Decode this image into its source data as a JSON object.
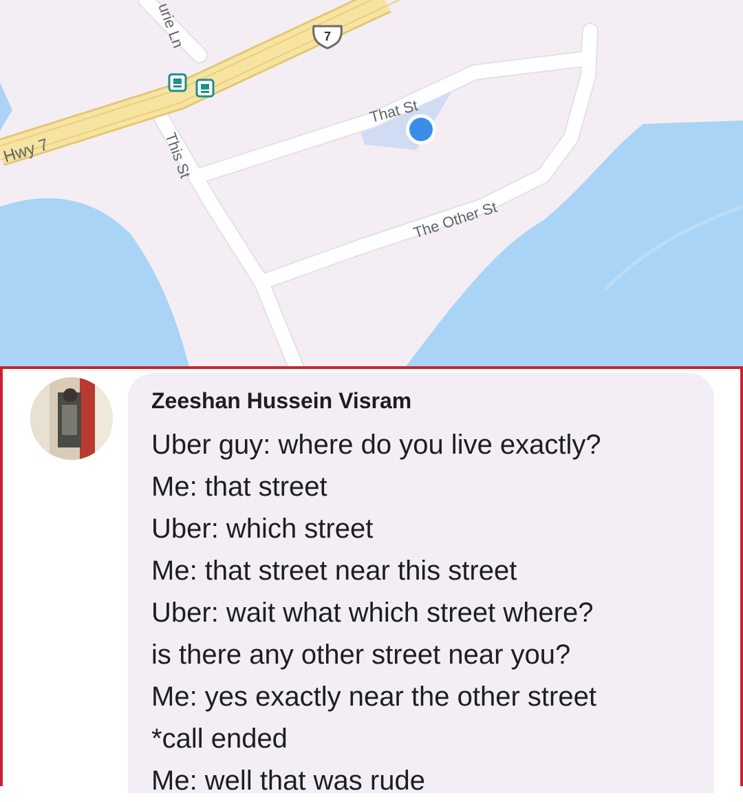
{
  "map": {
    "labels": {
      "highway": "Hwy 7",
      "route_shield": "7",
      "lane": "urie Ln",
      "this_st": "This St",
      "that_st": "That St",
      "other_st": "The Other St"
    },
    "colors": {
      "land": "#f4eef4",
      "water": "#aad4f5",
      "highway": "#f7e3a2",
      "road": "#ffffff",
      "location_dot": "#3b8ee8",
      "transit_icon": "#1e8f8a"
    },
    "icons": [
      "bus-stop-icon",
      "bus-stop-icon",
      "location-dot-icon",
      "route-shield-icon"
    ]
  },
  "comment": {
    "author": "Zeeshan Hussein Visram",
    "lines": [
      "Uber guy: where do you live exactly?",
      "Me: that street",
      "Uber: which street",
      "Me: that street near this street",
      "Uber: wait what which street where?",
      "is there any other street near you?",
      "Me: yes exactly near the other street",
      "*call ended",
      "Me: well that was rude"
    ],
    "colors": {
      "border": "#c8232c",
      "bubble": "#f3eef5",
      "text": "#1c1e21"
    }
  }
}
